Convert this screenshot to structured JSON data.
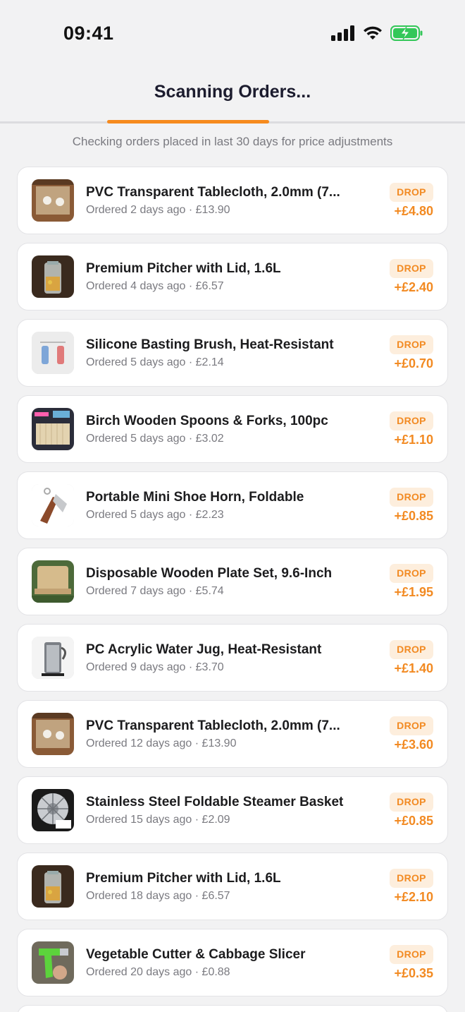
{
  "status": {
    "time": "09:41"
  },
  "header": {
    "title": "Scanning Orders...",
    "progress": 0.35,
    "subtitle": "Checking orders placed in last 30 days for price adjustments"
  },
  "colors": {
    "accent": "#f68a1e",
    "badge_bg": "#fdeedd",
    "battery": "#34c759"
  },
  "orders": [
    {
      "title": "PVC Transparent Tablecloth, 2.0mm (7...",
      "meta": "Ordered 2 days ago · £13.90",
      "badge": "DROP",
      "amount": "+£4.80",
      "thumb": "tablecloth-thumbnail"
    },
    {
      "title": "Premium Pitcher with Lid, 1.6L",
      "meta": "Ordered 4 days ago · £6.57",
      "badge": "DROP",
      "amount": "+£2.40",
      "thumb": "pitcher-thumbnail"
    },
    {
      "title": "Silicone Basting Brush, Heat-Resistant",
      "meta": "Ordered 5 days ago · £2.14",
      "badge": "DROP",
      "amount": "+£0.70",
      "thumb": "brush-thumbnail"
    },
    {
      "title": "Birch Wooden Spoons & Forks, 100pc",
      "meta": "Ordered 5 days ago · £3.02",
      "badge": "DROP",
      "amount": "+£1.10",
      "thumb": "spoons-thumbnail"
    },
    {
      "title": "Portable Mini Shoe Horn, Foldable",
      "meta": "Ordered 5 days ago · £2.23",
      "badge": "DROP",
      "amount": "+£0.85",
      "thumb": "shoe-horn-thumbnail"
    },
    {
      "title": "Disposable Wooden Plate Set, 9.6-Inch",
      "meta": "Ordered 7 days ago · £5.74",
      "badge": "DROP",
      "amount": "+£1.95",
      "thumb": "plate-thumbnail"
    },
    {
      "title": "PC Acrylic Water Jug, Heat-Resistant",
      "meta": "Ordered 9 days ago · £3.70",
      "badge": "DROP",
      "amount": "+£1.40",
      "thumb": "jug-thumbnail"
    },
    {
      "title": "PVC Transparent Tablecloth, 2.0mm (7...",
      "meta": "Ordered 12 days ago · £13.90",
      "badge": "DROP",
      "amount": "+£3.60",
      "thumb": "tablecloth-thumbnail"
    },
    {
      "title": "Stainless Steel Foldable Steamer Basket",
      "meta": "Ordered 15 days ago · £2.09",
      "badge": "DROP",
      "amount": "+£0.85",
      "thumb": "steamer-thumbnail"
    },
    {
      "title": "Premium Pitcher with Lid, 1.6L",
      "meta": "Ordered 18 days ago · £6.57",
      "badge": "DROP",
      "amount": "+£2.10",
      "thumb": "pitcher-thumbnail"
    },
    {
      "title": "Vegetable Cutter & Cabbage Slicer",
      "meta": "Ordered 20 days ago · £0.88",
      "badge": "DROP",
      "amount": "+£0.35",
      "thumb": "slicer-thumbnail"
    }
  ]
}
